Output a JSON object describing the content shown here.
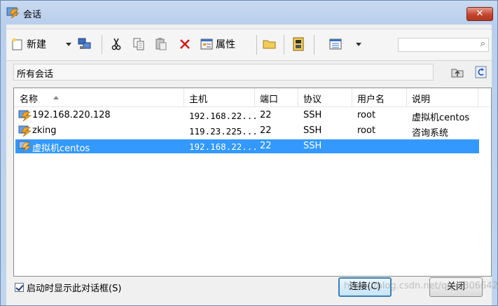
{
  "window": {
    "title": "会话",
    "close_label": "✕"
  },
  "toolbar": {
    "new_label": "新建",
    "properties_label": "属性",
    "search_placeholder": "",
    "search_icon": "⌕"
  },
  "path_bar": {
    "label": "所有会话"
  },
  "list": {
    "headers": [
      "名称",
      "主机",
      "端口",
      "协议",
      "用户名",
      "说明"
    ],
    "rows": [
      {
        "name": "192.168.220.128",
        "host": "192.168.22...",
        "port": "22",
        "protocol": "SSH",
        "user": "root",
        "desc": "虚拟机centos"
      },
      {
        "name": "zking",
        "host": "119.23.225...",
        "port": "22",
        "protocol": "SSH",
        "user": "root",
        "desc": "咨询系统"
      },
      {
        "name": "虚拟机centos",
        "host": "192.168.22...",
        "port": "22",
        "protocol": "SSH",
        "user": "",
        "desc": ""
      }
    ]
  },
  "footer": {
    "startup_checkbox_label": "启动时显示此对话框(S)",
    "startup_checked": true,
    "connect_label": "连接(C)",
    "close_label": "关闭",
    "watermark": "https://blog.csdn.net/qq_43066421"
  },
  "colors": {
    "selection": "#3399ff",
    "close_button": "#c5452e"
  }
}
